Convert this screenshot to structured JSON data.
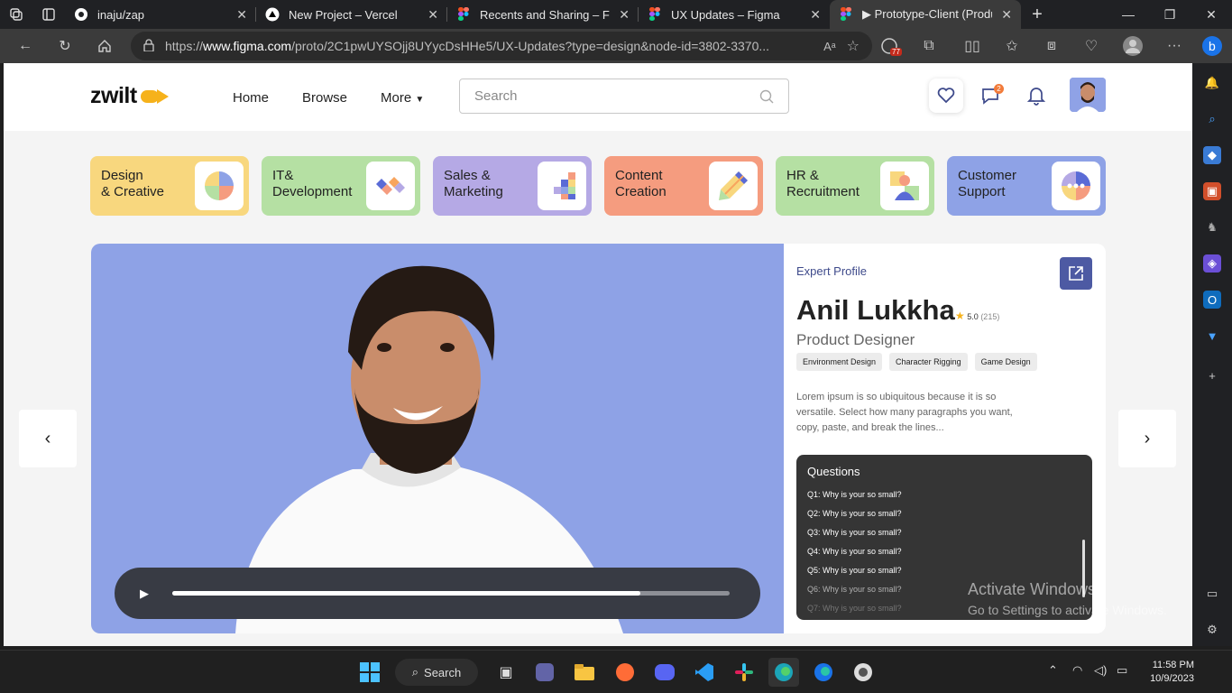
{
  "browser": {
    "tabs": [
      {
        "title": "inaju/zap",
        "icon": "github-icon"
      },
      {
        "title": "New Project – Vercel",
        "icon": "vercel-icon"
      },
      {
        "title": "Recents and Sharing – Figm",
        "icon": "figma-icon"
      },
      {
        "title": "UX Updates – Figma",
        "icon": "figma-icon"
      },
      {
        "title": "▶ Prototype-Client (Produc",
        "icon": "figma-icon",
        "active": true
      }
    ],
    "url_prefix": "https://",
    "url_domain": "www.figma.com",
    "url_path": "/proto/2C1pwUYSOjj8UYycDsHHe5/UX-Updates?type=design&node-id=3802-3370...",
    "extension_badge": "77"
  },
  "site": {
    "logo_text": "zwilt",
    "nav": {
      "home": "Home",
      "browse": "Browse",
      "more": "More"
    },
    "search_placeholder": "Search",
    "message_badge": "2"
  },
  "categories": [
    {
      "line1": "Design",
      "line2": "& Creative",
      "color": "#f8d77e",
      "icon": "pie-chart-icon"
    },
    {
      "line1": "IT&",
      "line2": "Development",
      "color": "#b5e0a3",
      "icon": "code-diamonds-icon"
    },
    {
      "line1": "Sales &",
      "line2": "Marketing",
      "color": "#b5a9e5",
      "icon": "bars-blocks-icon"
    },
    {
      "line1": "Content",
      "line2": "Creation",
      "color": "#f59c7f",
      "icon": "pencil-icon"
    },
    {
      "line1": "HR &",
      "line2": "Recruitment",
      "color": "#b5e0a3",
      "icon": "person-icon"
    },
    {
      "line1": "Customer",
      "line2": "Support",
      "color": "#8ea2e6",
      "icon": "chat-bubble-icon"
    }
  ],
  "video": {
    "progress": 0.84
  },
  "profile": {
    "label": "Expert Profile",
    "name": "Anil Lukkha",
    "rating": "5.0",
    "reviews": "(215)",
    "role": "Product Designer",
    "tags": [
      "Environment Design",
      "Character Rigging",
      "Game Design"
    ],
    "description": "Lorem ipsum is so ubiquitous because it is so versatile. Select how many paragraphs you want, copy, paste, and break the lines..."
  },
  "questions": {
    "title": "Questions",
    "items": [
      "Q1:  Why is your so small?",
      "Q2:  Why is your so small?",
      "Q3:  Why is your so small?",
      "Q4:  Why is your so small?",
      "Q5:  Why is your so small?",
      "Q6:  Why is your so small?",
      "Q7:  Why is your so small?"
    ]
  },
  "watermark": {
    "line1": "Activate Windows",
    "line2": "Go to Settings to activate Windows."
  },
  "taskbar": {
    "search": "Search",
    "time": "11:58 PM",
    "date": "10/9/2023"
  }
}
